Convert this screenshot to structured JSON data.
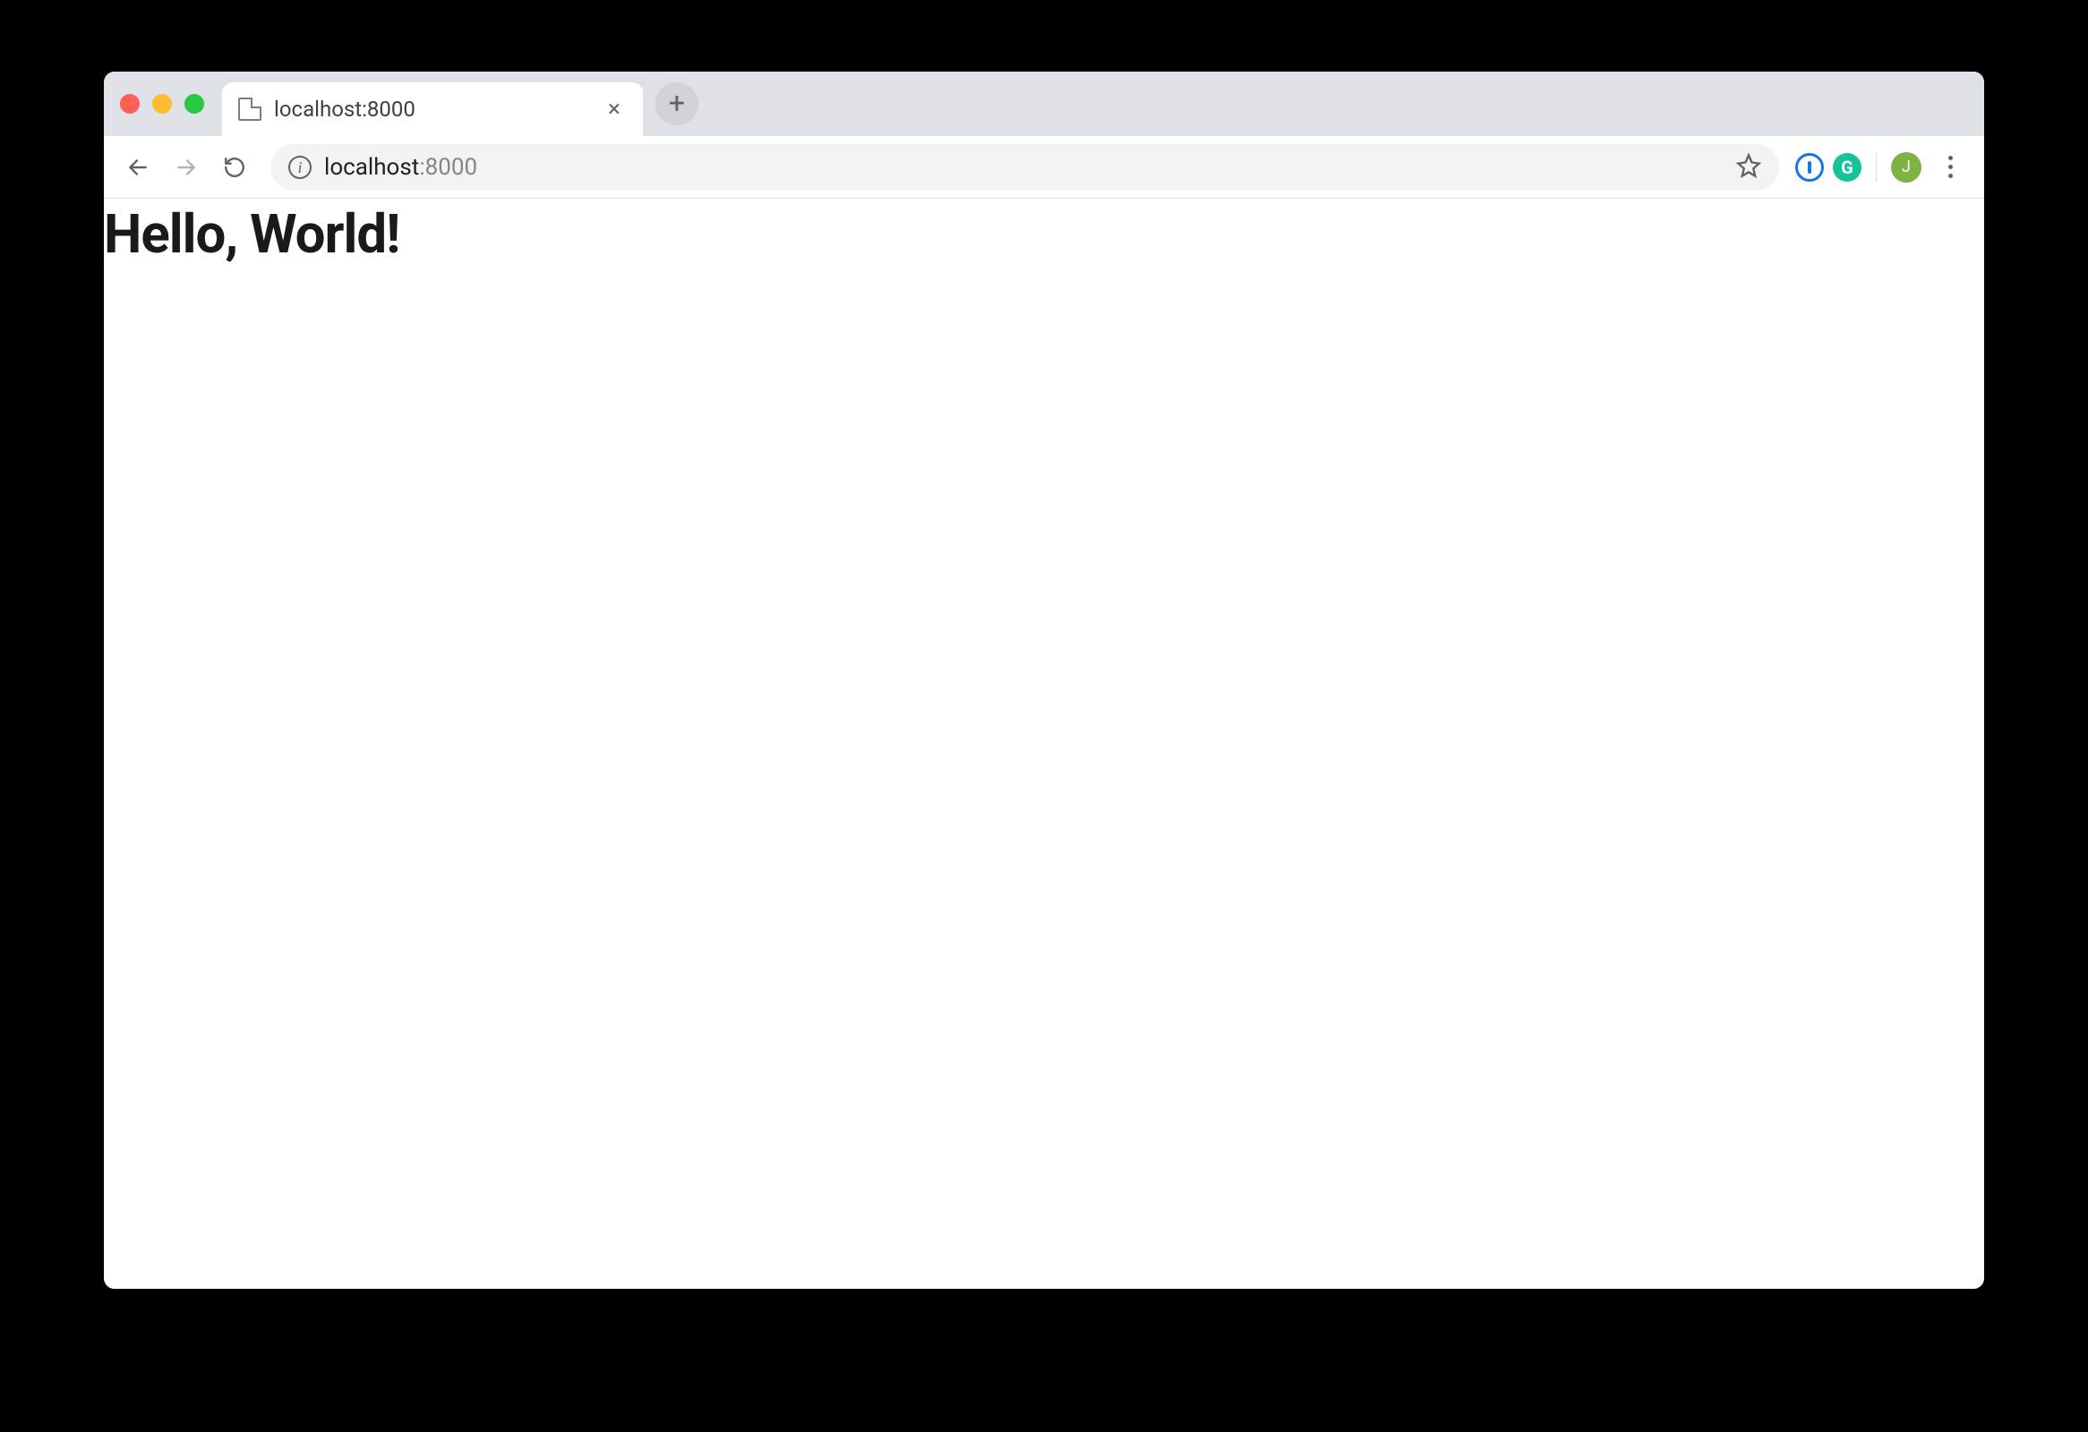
{
  "window_controls": {
    "close": "close",
    "minimize": "minimize",
    "maximize": "maximize"
  },
  "tab": {
    "title": "localhost:8000",
    "favicon": "page-icon"
  },
  "toolbar": {
    "back_enabled": true,
    "forward_enabled": false,
    "url_host": "localhost",
    "url_port": ":8000",
    "site_info_label": "i"
  },
  "extensions": [
    {
      "name": "1password",
      "glyph": "①",
      "color": "#1a73e8"
    },
    {
      "name": "grammarly",
      "glyph": "G",
      "color": "#15c39a"
    }
  ],
  "profile": {
    "avatar_initial": "J",
    "avatar_color": "#7cb342"
  },
  "page": {
    "heading": "Hello, World!"
  }
}
